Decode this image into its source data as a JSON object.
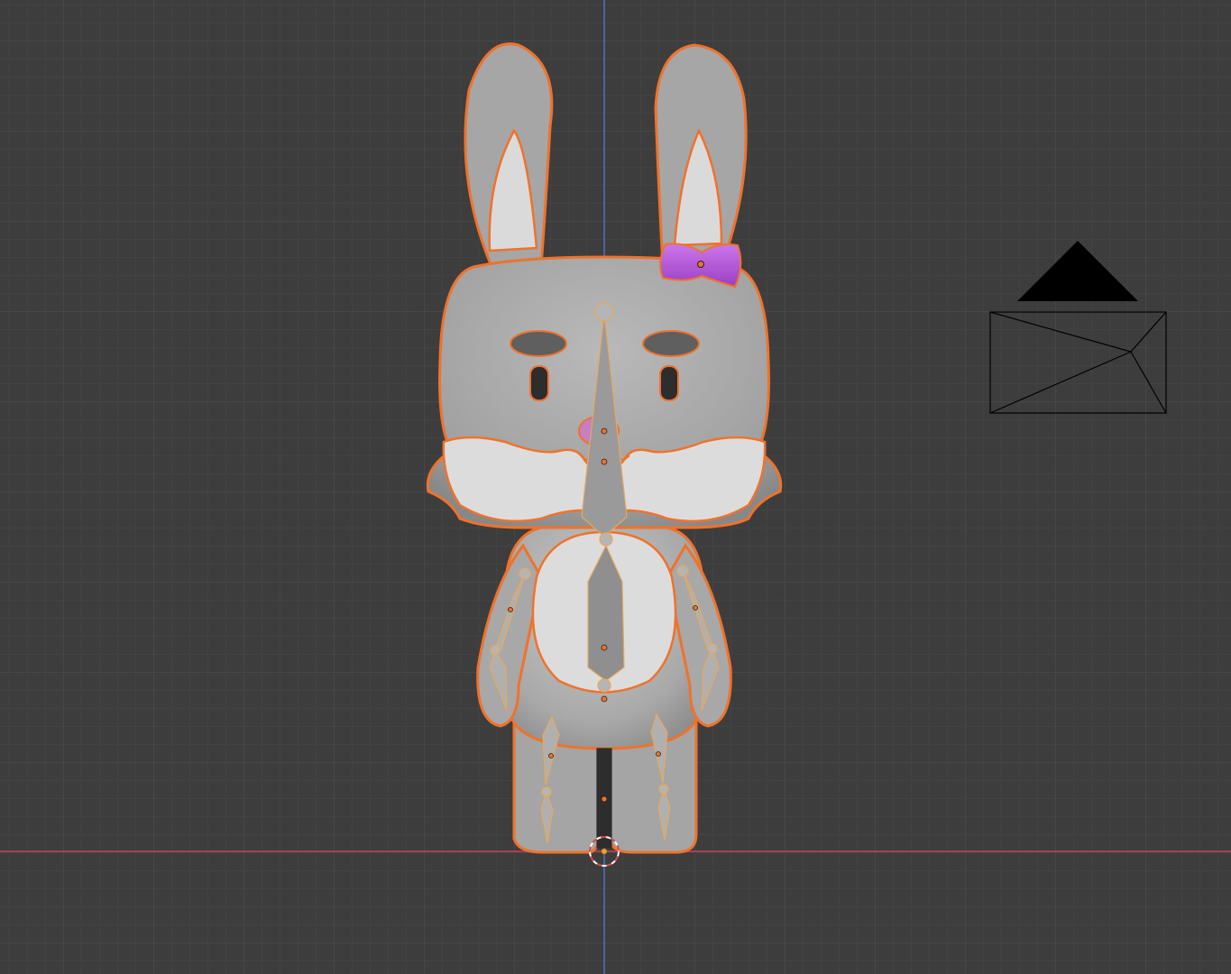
{
  "viewport": {
    "view": "front-orthographic",
    "grid": true,
    "colors": {
      "background": "#3d3d3d",
      "x_axis": "#c0455a",
      "z_axis": "#4a74b8",
      "selection_outline": "#f0722b",
      "armature": "#e8a85a",
      "bow": "#b45ad6"
    }
  },
  "scene": {
    "objects": [
      {
        "name": "bunny-mesh",
        "type": "mesh",
        "selected": true
      },
      {
        "name": "bow-mesh",
        "type": "mesh",
        "selected": true
      },
      {
        "name": "armature",
        "type": "armature",
        "selected": true
      },
      {
        "name": "camera",
        "type": "camera",
        "selected": false
      },
      {
        "name": "3d-cursor",
        "type": "cursor"
      }
    ]
  }
}
